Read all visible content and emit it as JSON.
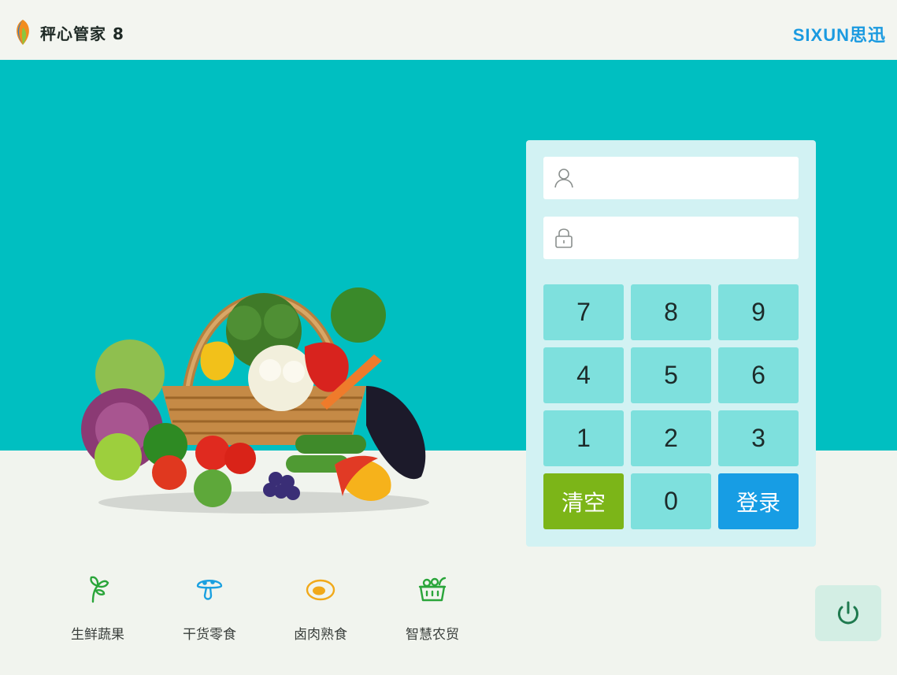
{
  "header": {
    "app_title": "秤心管家 8",
    "brand": "SIXUN思迅",
    "brand_color": "#1a9ae0"
  },
  "hero": {
    "background_color": "#00bfc1",
    "image_icon": "vegetable-basket-image"
  },
  "login": {
    "username": {
      "icon": "user-icon",
      "value": "",
      "placeholder": ""
    },
    "password": {
      "icon": "lock-icon",
      "value": "",
      "placeholder": ""
    },
    "keypad": {
      "k7": "7",
      "k8": "8",
      "k9": "9",
      "k4": "4",
      "k5": "5",
      "k6": "6",
      "k1": "1",
      "k2": "2",
      "k3": "3",
      "k0": "0",
      "clear": "清空",
      "submit": "登录"
    },
    "colors": {
      "key": "#7ee0dd",
      "clear": "#7cb518",
      "submit": "#179de4"
    }
  },
  "categories": [
    {
      "label": "生鲜蔬果",
      "icon": "vegetable-icon"
    },
    {
      "label": "干货零食",
      "icon": "mushroom-icon"
    },
    {
      "label": "卤肉熟食",
      "icon": "egg-icon"
    },
    {
      "label": "智慧农贸",
      "icon": "produce-basket-icon"
    }
  ],
  "power": {
    "icon": "power-icon"
  }
}
